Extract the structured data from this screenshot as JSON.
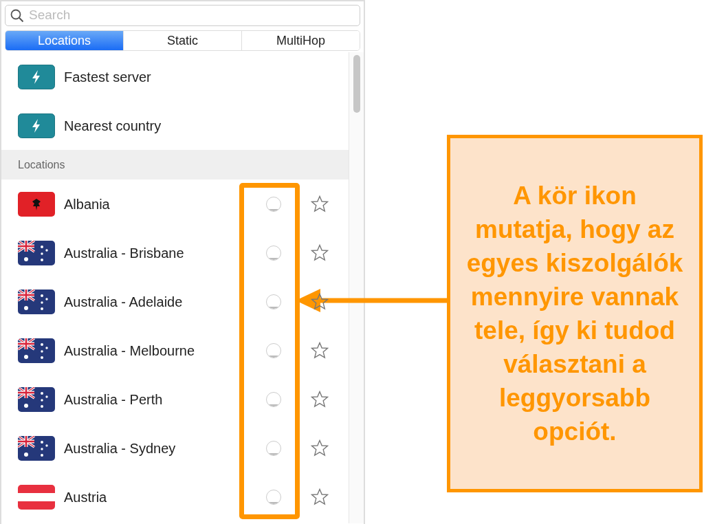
{
  "search": {
    "placeholder": "Search"
  },
  "tabs": [
    {
      "label": "Locations",
      "selected": true
    },
    {
      "label": "Static",
      "selected": false
    },
    {
      "label": "MultiHop",
      "selected": false
    }
  ],
  "quick_items": [
    {
      "label": "Fastest server"
    },
    {
      "label": "Nearest country"
    }
  ],
  "section_header": "Locations",
  "locations": [
    {
      "name": "Albania",
      "kind": "albania",
      "favorite": false
    },
    {
      "name": "Australia - Brisbane",
      "kind": "australia",
      "favorite": false
    },
    {
      "name": "Australia - Adelaide",
      "kind": "australia",
      "favorite": false
    },
    {
      "name": "Australia - Melbourne",
      "kind": "australia",
      "favorite": false
    },
    {
      "name": "Australia - Perth",
      "kind": "australia",
      "favorite": false
    },
    {
      "name": "Australia - Sydney",
      "kind": "australia",
      "favorite": false
    },
    {
      "name": "Austria",
      "kind": "austria",
      "favorite": false
    }
  ],
  "callout": {
    "text": "A kör ikon mutatja, hogy az egyes kiszolgálók mennyire vannak tele, így ki tudod választani a leggyorsabb opciót."
  }
}
